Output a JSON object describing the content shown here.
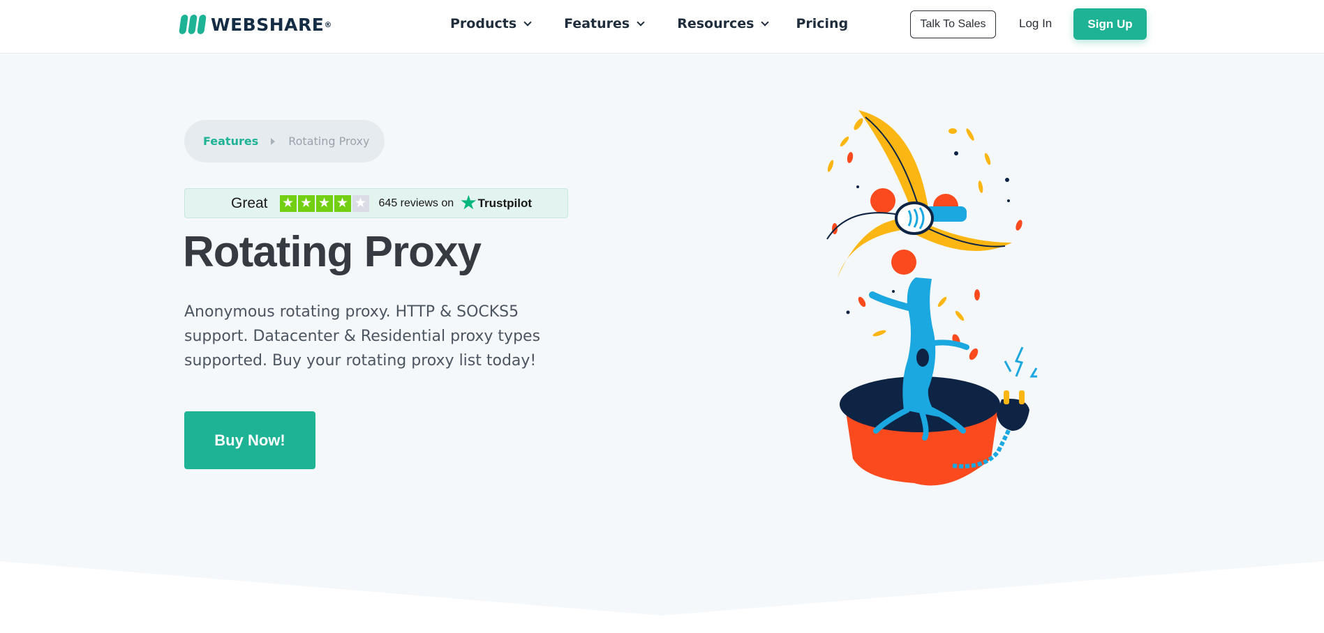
{
  "header": {
    "logo_text": "WEBSHARE",
    "logo_reg": "®",
    "nav": [
      {
        "label": "Products",
        "has_dropdown": true
      },
      {
        "label": "Features",
        "has_dropdown": true
      },
      {
        "label": "Resources",
        "has_dropdown": true
      },
      {
        "label": "Pricing",
        "has_dropdown": false
      }
    ],
    "talk_to_sales": "Talk To Sales",
    "login": "Log In",
    "signup": "Sign Up"
  },
  "breadcrumb": {
    "parent": "Features",
    "current": "Rotating Proxy"
  },
  "trustpilot": {
    "rating_word": "Great",
    "stars_filled": 4,
    "stars_total": 5,
    "reviews_text": "645 reviews on",
    "brand": "Trustpilot"
  },
  "hero": {
    "title": "Rotating Proxy",
    "description": "Anonymous rotating proxy. HTTP & SOCKS5 support. Datacenter & Residential proxy types supported. Buy your rotating proxy list today!",
    "cta": "Buy Now!"
  },
  "colors": {
    "brand": "#1eb395",
    "hero_bg": "#f5f8fb",
    "trustpilot_star": "#73cf11",
    "trustpilot_logo": "#00b67a",
    "illustration_yellow": "#fbb614",
    "illustration_blue": "#1ba7e0",
    "illustration_red": "#fb4b1e",
    "illustration_navy": "#0e2444"
  }
}
